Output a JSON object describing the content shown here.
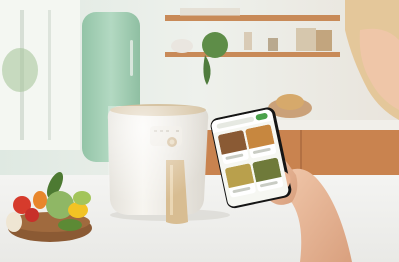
{
  "scene": {
    "subject": "air-fryer-with-smartphone-app",
    "colors": {
      "wall": "#e9eee6",
      "shelf": "#c98a57",
      "fridge": "#a8d0b7",
      "counter": "#f3f3f1",
      "airfryer": "#f2efe8",
      "airfryer_lid": "#d9c6a5",
      "handle": "#d9c19a",
      "phone": "#1a1a1a",
      "skin": "#e8b697",
      "app_accent": "#4aa14b"
    }
  }
}
